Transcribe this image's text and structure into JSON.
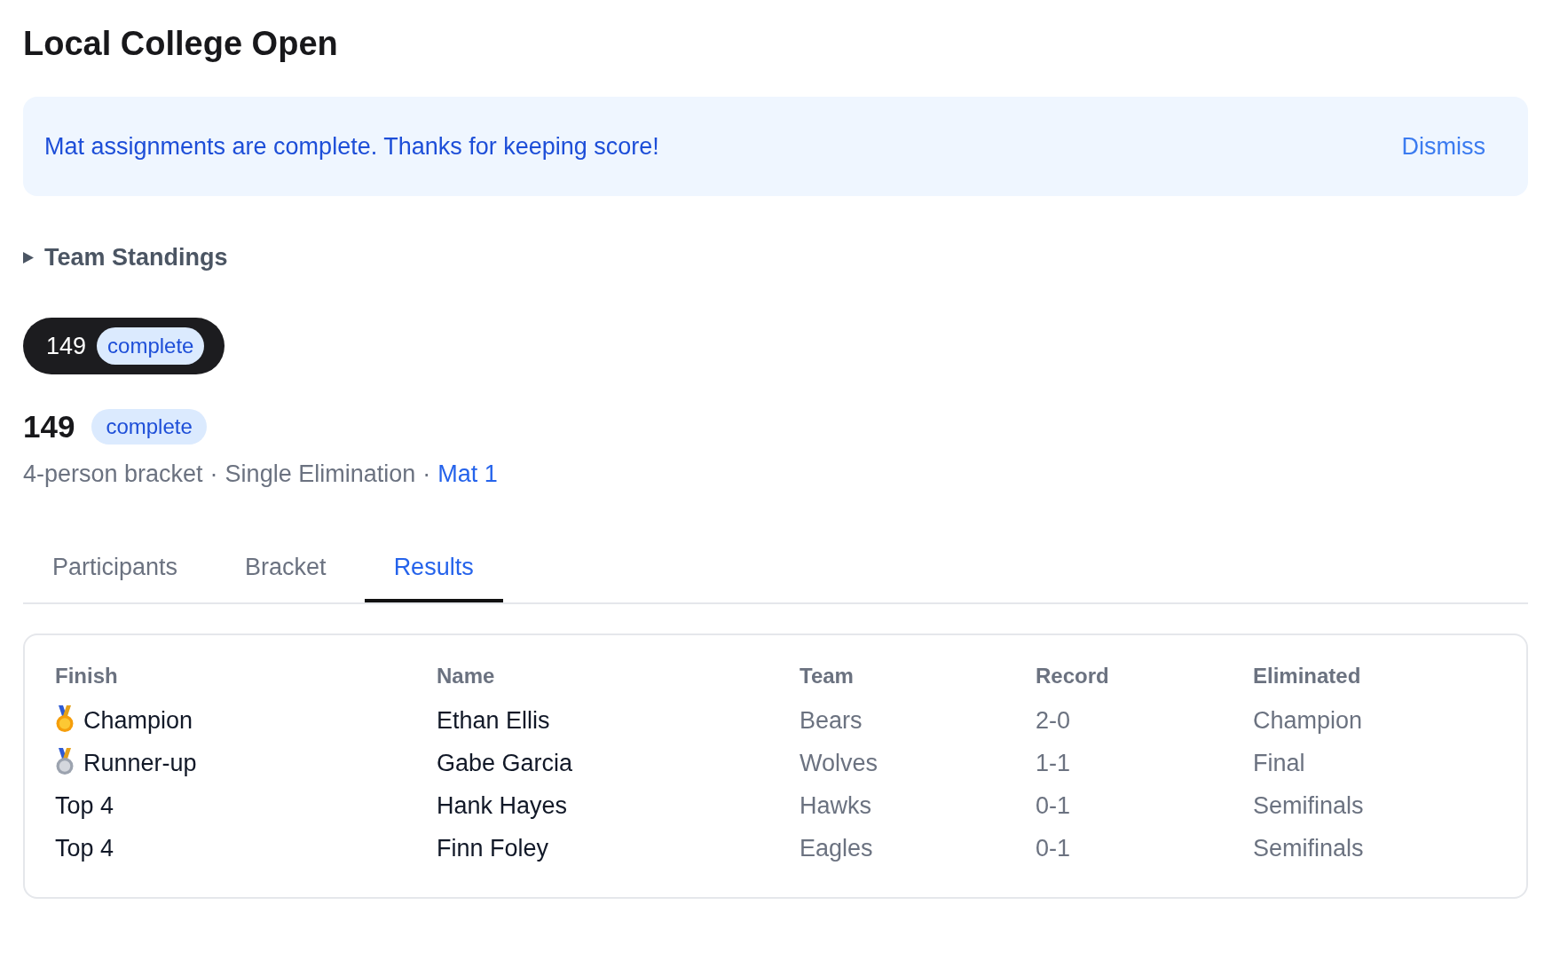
{
  "page": {
    "title": "Local College Open"
  },
  "banner": {
    "message": "Mat assignments are complete. Thanks for keeping score!",
    "action": "Dismiss"
  },
  "team_standings": {
    "label": "Team Standings",
    "expanded": false
  },
  "bracket_chip": {
    "label": "149",
    "status": "complete"
  },
  "bracket": {
    "title": "149",
    "status": "complete",
    "meta": [
      {
        "kind": "text",
        "text": "4-person bracket"
      },
      {
        "kind": "separator",
        "text": "·"
      },
      {
        "kind": "text",
        "text": "Single Elimination"
      },
      {
        "kind": "separator",
        "text": "·"
      },
      {
        "kind": "link",
        "text": "Mat 1"
      }
    ]
  },
  "tabs": [
    {
      "label": "Participants",
      "selected": false
    },
    {
      "label": "Bracket",
      "selected": false
    },
    {
      "label": "Results",
      "selected": true
    }
  ],
  "results": {
    "columns": [
      "Finish",
      "Name",
      "Team",
      "Record",
      "Eliminated"
    ],
    "rows": [
      {
        "kind": "gold",
        "cells": [
          "Champion",
          "Ethan Ellis",
          "Bears",
          "2-0",
          "Champion"
        ]
      },
      {
        "kind": "silver",
        "cells": [
          "Runner-up",
          "Gabe Garcia",
          "Wolves",
          "1-1",
          "Final"
        ]
      },
      {
        "kind": "plain",
        "cells": [
          "Top 4",
          "Hank Hayes",
          "Hawks",
          "0-1",
          "Semifinals"
        ]
      },
      {
        "kind": "plain",
        "cells": [
          "Top 4",
          "Finn Foley",
          "Eagles",
          "0-1",
          "Semifinals"
        ]
      }
    ]
  }
}
